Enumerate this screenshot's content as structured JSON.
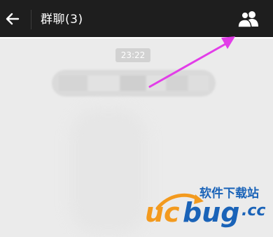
{
  "header": {
    "title": "群聊(3)",
    "back_icon": "arrow-left-icon",
    "members_icon": "group-members-icon",
    "background": "#1e1e1e"
  },
  "chat": {
    "timestamp": "23:22",
    "background": "#ebebeb"
  },
  "annotation": {
    "arrow_color": "#e23de8"
  },
  "watermark": {
    "text_cn": "软件下载站",
    "brand": "ucbug.cc",
    "accent_orange": "#f39a1e",
    "accent_blue": "#1a63b8"
  }
}
